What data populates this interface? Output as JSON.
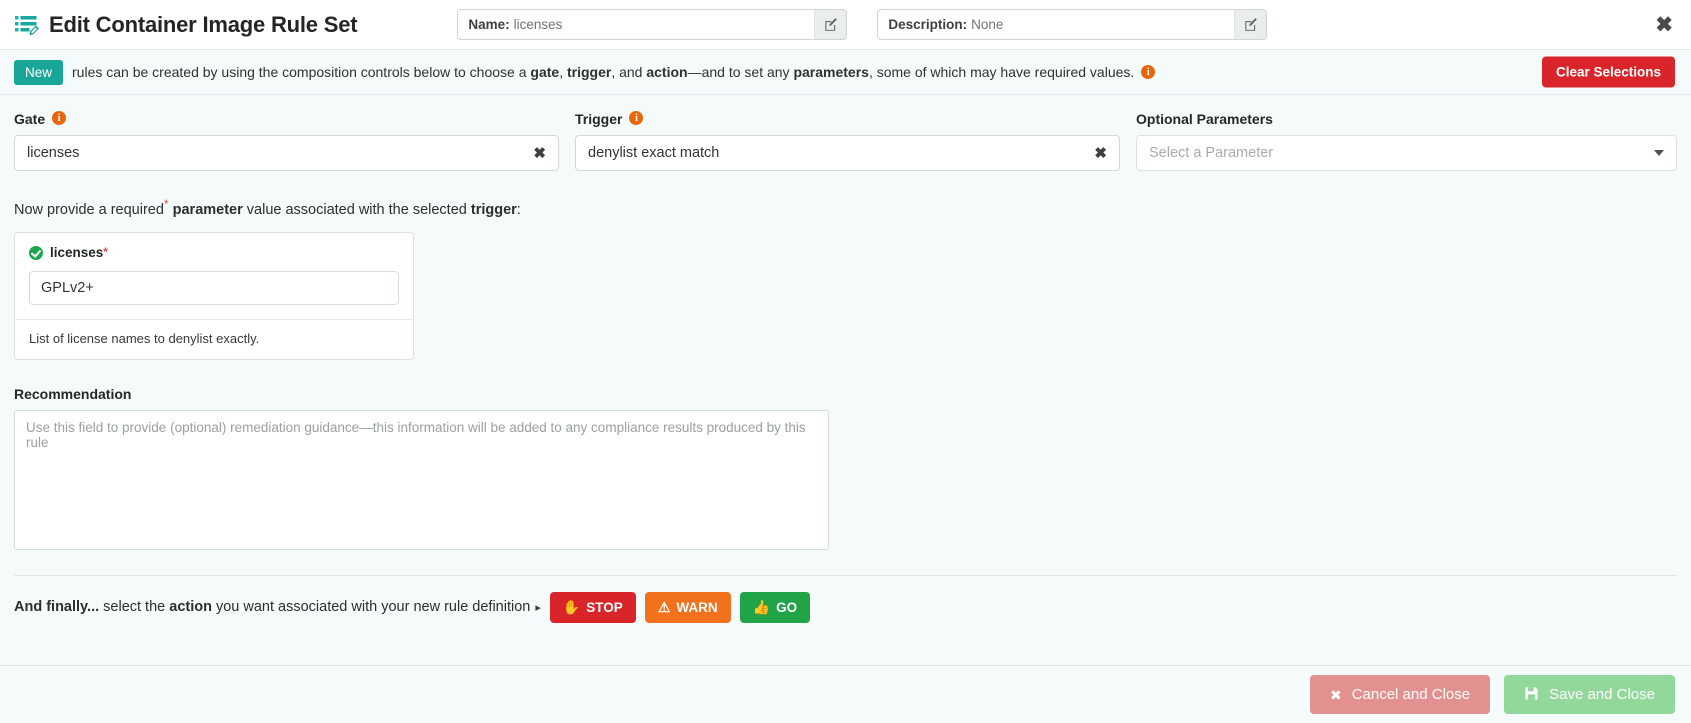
{
  "header": {
    "title": "Edit Container Image Rule Set",
    "title_icon": "list-edit-icon",
    "name_field": {
      "label": "Name:",
      "value": "licenses",
      "edit_icon": "pencil-square-icon"
    },
    "description_field": {
      "label": "Description:",
      "value": "None",
      "edit_icon": "pencil-square-icon"
    },
    "close_icon": "close-x-icon"
  },
  "infobar": {
    "badge": "New",
    "text_part1": "rules can be created by using the composition controls below to choose a ",
    "bold_gate": "gate",
    "text_sep1": ", ",
    "bold_trigger": "trigger",
    "text_sep2": ", and ",
    "bold_action": "action",
    "text_part2": "—and to set any ",
    "bold_parameters": "parameters",
    "text_part3": ", some of which may have required values.",
    "info_icon": "info-circle-icon",
    "clear_button": "Clear Selections"
  },
  "compose": {
    "gate": {
      "label": "Gate",
      "info_icon": "info-circle-icon",
      "value": "licenses",
      "clear_icon": "clear-x-icon"
    },
    "trigger": {
      "label": "Trigger",
      "info_icon": "info-circle-icon",
      "value": "denylist exact match",
      "clear_icon": "clear-x-icon"
    },
    "optional_parameters": {
      "label": "Optional Parameters",
      "placeholder": "Select a Parameter",
      "caret_icon": "chevron-down-icon"
    }
  },
  "parameter_section": {
    "instruction_pre": "Now provide a required",
    "instruction_star": "*",
    "instruction_bold_parameter": "parameter",
    "instruction_mid": " value associated with the selected ",
    "instruction_bold_trigger": "trigger",
    "instruction_post": ":",
    "card": {
      "status_icon": "check-circle-icon",
      "name": "licenses",
      "required_star": "*",
      "value": "GPLv2+",
      "help_text": "List of license names to denylist exactly."
    }
  },
  "recommendation": {
    "label": "Recommendation",
    "value": "",
    "placeholder": "Use this field to provide (optional) remediation guidance—this information will be added to any compliance results produced by this rule"
  },
  "action_section": {
    "text_bold": "And finally...",
    "text_mid1": " select the ",
    "text_bold2": "action",
    "text_mid2": " you want associated with your new rule definition",
    "arrow": "▸",
    "buttons": [
      {
        "label": "STOP",
        "icon": "hand-stop-icon",
        "color": "#d9252a"
      },
      {
        "label": "WARN",
        "icon": "warning-triangle-icon",
        "color": "#f2711c"
      },
      {
        "label": "GO",
        "icon": "thumbs-up-icon",
        "color": "#21a347"
      }
    ]
  },
  "footer": {
    "cancel": {
      "label": "Cancel and Close",
      "icon": "close-x-icon",
      "color": "#e39091"
    },
    "save": {
      "label": "Save and Close",
      "icon": "floppy-save-icon",
      "color": "#93d89b"
    }
  }
}
